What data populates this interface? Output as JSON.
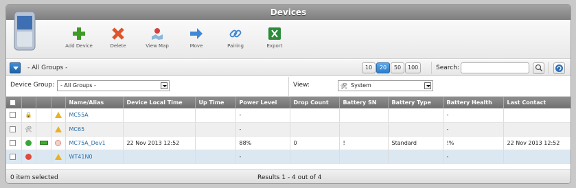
{
  "window": {
    "title": "Devices"
  },
  "toolbar": {
    "items": [
      {
        "label": "Add Device",
        "icon": "plus-icon",
        "color": "#3e9c26"
      },
      {
        "label": "Delete",
        "icon": "delete-x-icon",
        "color": "#e0542a"
      },
      {
        "label": "View Map",
        "icon": "map-icon",
        "color": "#5a86b8"
      },
      {
        "label": "Move",
        "icon": "move-arrow-icon",
        "color": "#3f88d6"
      },
      {
        "label": "Pairing",
        "icon": "link-icon",
        "color": "#3f88d6"
      },
      {
        "label": "Export",
        "icon": "excel-icon",
        "color": "#2d8a3a"
      }
    ]
  },
  "groups_bar": {
    "current_group": "- All Groups -",
    "page_sizes": [
      "10",
      "20",
      "50",
      "100"
    ],
    "active_page_size": "20",
    "search_label": "Search:",
    "search_value": ""
  },
  "filters": {
    "device_group_label": "Device Group:",
    "device_group_value": "- All Groups -",
    "view_label": "View:",
    "view_value": "System"
  },
  "table": {
    "columns": [
      "",
      "",
      "",
      "",
      "Name/Alias",
      "Device Local Time",
      "Up Time",
      "Power Level",
      "Drop Count",
      "Battery SN",
      "Battery Type",
      "Battery Health",
      "Last Contact"
    ],
    "rows": [
      {
        "status_icon": "lock-icon",
        "connection_icon": "",
        "warning": true,
        "name": "MC55A",
        "local_time": "",
        "up_time": "",
        "power": "-",
        "drop": "",
        "sn": "",
        "type": "",
        "health": "-",
        "last": ""
      },
      {
        "status_icon": "tools-icon",
        "connection_icon": "",
        "warning": true,
        "name": "MC65",
        "local_time": "",
        "up_time": "",
        "power": "-",
        "drop": "",
        "sn": "",
        "type": "",
        "health": "-",
        "last": ""
      },
      {
        "status_icon": "ok-check-icon",
        "connection_icon": "battery-icon",
        "warning": false,
        "name": "MC75A_Dev1",
        "local_time": "22 Nov 2013 12:52",
        "up_time": "",
        "power": "88%",
        "drop": "0",
        "sn": "!",
        "type": "Standard",
        "health": "!%",
        "last": "22 Nov 2013 12:52"
      },
      {
        "status_icon": "blocked-icon",
        "connection_icon": "",
        "warning": true,
        "name": "WT41N0",
        "local_time": "",
        "up_time": "",
        "power": "-",
        "drop": "",
        "sn": "",
        "type": "",
        "health": "-",
        "last": ""
      }
    ]
  },
  "status": {
    "selected": "0 item selected",
    "results": "Results 1 - 4 out of 4"
  },
  "colors": {
    "accent": "#2b7cca",
    "header": "#7c7c7c",
    "link": "#2a6ea6",
    "warning": "#e8b222"
  }
}
